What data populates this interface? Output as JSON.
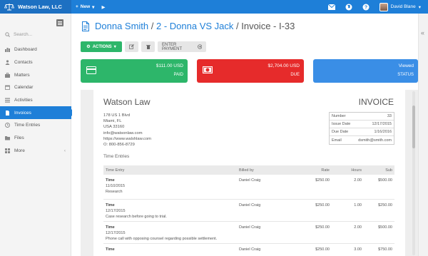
{
  "topbar": {
    "brand": "Watson Law, LLC",
    "new_label": "New",
    "user_name": "David Blane"
  },
  "sidebar": {
    "search_placeholder": "Search...",
    "items": [
      {
        "label": "Dashboard",
        "icon": "gauge-icon"
      },
      {
        "label": "Contacts",
        "icon": "users-icon"
      },
      {
        "label": "Matters",
        "icon": "briefcase-icon"
      },
      {
        "label": "Calendar",
        "icon": "calendar-icon"
      },
      {
        "label": "Activities",
        "icon": "list-icon"
      },
      {
        "label": "Invoices",
        "icon": "file-icon",
        "active": true
      },
      {
        "label": "Time Entries",
        "icon": "clock-icon"
      },
      {
        "label": "Files",
        "icon": "folder-icon"
      },
      {
        "label": "More",
        "icon": "grid-icon"
      }
    ]
  },
  "header": {
    "contact": "Donna Smith",
    "sep1": " / ",
    "matter": "2 - Donna VS Jack",
    "sep2": " / ",
    "invoice": "Invoice - I-33"
  },
  "actions": {
    "actions_label": "ACTIONS",
    "enter_payment_label": "ENTER PAYMENT"
  },
  "cards": {
    "paid": {
      "amount": "$111.00",
      "currency": "USD",
      "label": "PAID"
    },
    "due": {
      "amount": "$2,704.00",
      "currency": "USD",
      "label": "DUE"
    },
    "status": {
      "value": "Viewed",
      "label": "STATUS"
    }
  },
  "invoice": {
    "firm": "Watson Law",
    "title": "INVOICE",
    "address": [
      "178 US 1 Blvd",
      "Miami, FL",
      "USA 33160",
      "info@watsonlaw.com",
      "https://www.walshlaw.com",
      "O: 800-856-8729"
    ],
    "meta": [
      {
        "k": "Number",
        "v": "33"
      },
      {
        "k": "Issue Date",
        "v": "12/17/2015"
      },
      {
        "k": "Due Date",
        "v": "1/16/2016"
      },
      {
        "k": "Email",
        "v": "dsmith@smith.com"
      }
    ],
    "entries_title": "Time Entries",
    "columns": [
      "Time Entry",
      "Billed by",
      "Rate",
      "Hours",
      "Sub"
    ],
    "rows": [
      {
        "type": "Time",
        "date": "11/10/2015",
        "desc": "Research",
        "billed_by": "Daniel Craig",
        "rate": "$250.00",
        "hours": "2.00",
        "sub": "$500.00"
      },
      {
        "type": "Time",
        "date": "12/17/2015",
        "desc": "Case research before going to trial.",
        "billed_by": "Daniel Craig",
        "rate": "$250.00",
        "hours": "1.00",
        "sub": "$250.00"
      },
      {
        "type": "Time",
        "date": "12/17/2015",
        "desc": "Phone call with opposing counsel regarding possible settlement.",
        "billed_by": "Daniel Craig",
        "rate": "$250.00",
        "hours": "2.00",
        "sub": "$500.00"
      },
      {
        "type": "Time",
        "date": "",
        "desc": "",
        "billed_by": "Daniel Craig",
        "rate": "$250.00",
        "hours": "3.00",
        "sub": "$750.00"
      }
    ]
  },
  "colors": {
    "primary": "#1e7fd8",
    "success": "#2db66a",
    "danger": "#e62b2b",
    "info": "#3a8ee6"
  }
}
